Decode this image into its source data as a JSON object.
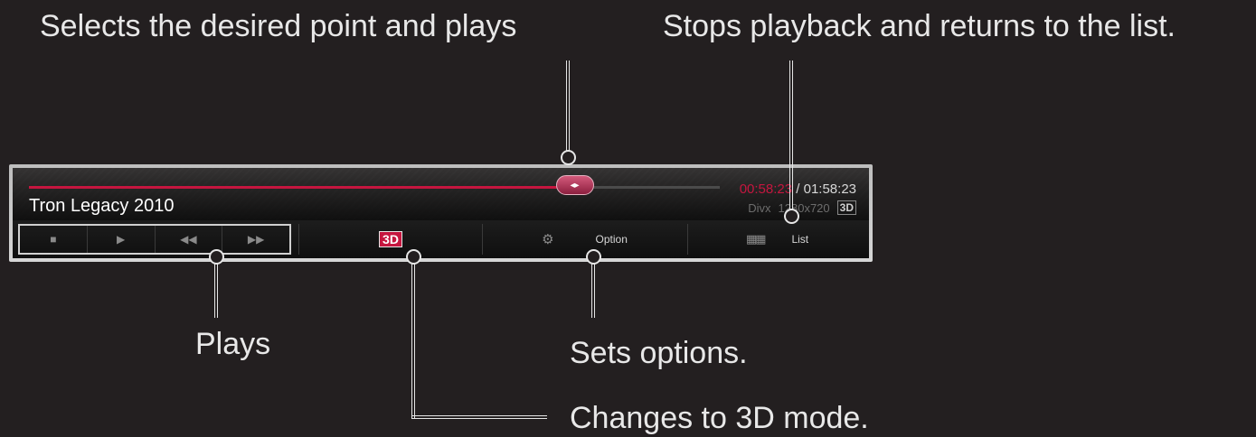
{
  "callouts": {
    "seek": "Selects the desired point and plays",
    "list": "Stops playback and returns to the list.",
    "plays": "Plays",
    "options": "Sets options.",
    "mode3d": "Changes to 3D mode."
  },
  "player": {
    "title": "Tron Legacy 2010",
    "current_time": "00:58:23",
    "time_separator": "/",
    "total_time": "01:58:23",
    "format": "Divx",
    "resolution": "1280x720",
    "badge_3d": "3D",
    "progress_fraction": 0.79,
    "handle_glyph": "◂▸"
  },
  "controls": {
    "playback_buttons": [
      {
        "icon": "stop-icon",
        "glyph": "■"
      },
      {
        "icon": "play-icon",
        "glyph": "▶"
      },
      {
        "icon": "rewind-icon",
        "glyph": "◀◀"
      },
      {
        "icon": "fast-forward-icon",
        "glyph": "▶▶"
      }
    ],
    "mode3d_label": "3D",
    "option_icon": "gear-icon",
    "option_glyph": "⚙",
    "option_label": "Option",
    "list_icon": "grid-icon",
    "list_glyph": "▦▦",
    "list_label": "List"
  },
  "colors": {
    "accent": "#c5163f",
    "background": "#231f20"
  }
}
